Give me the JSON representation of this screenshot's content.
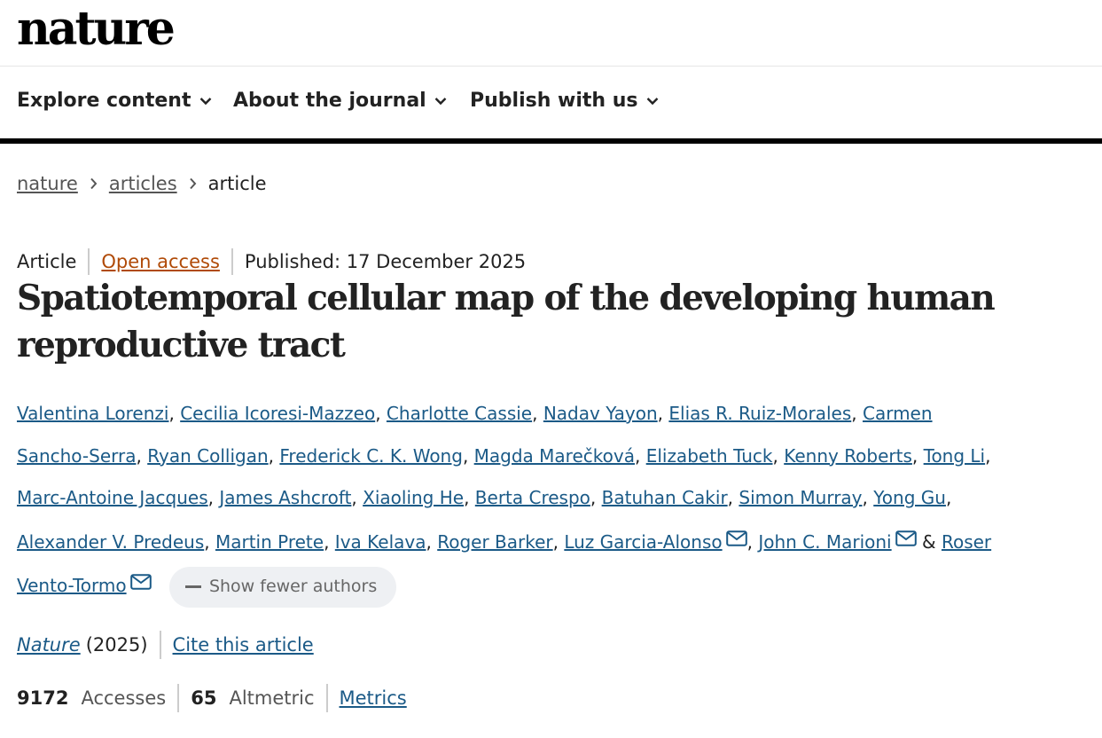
{
  "header": {
    "logo": "nature"
  },
  "nav": {
    "items": [
      {
        "label": "Explore content"
      },
      {
        "label": "About the journal"
      },
      {
        "label": "Publish with us"
      }
    ]
  },
  "breadcrumb": {
    "items": [
      "nature",
      "articles"
    ],
    "current": "article"
  },
  "meta": {
    "type": "Article",
    "access": "Open access",
    "published": "Published: 17 December 2025"
  },
  "article": {
    "title": "Spatiotemporal cellular map of the developing human reproductive tract"
  },
  "authors": {
    "list": [
      "Valentina Lorenzi",
      "Cecilia Icoresi-Mazzeo",
      "Charlotte Cassie",
      "Nadav Yayon",
      "Elias R. Ruiz-Morales",
      "Carmen Sancho-Serra",
      "Ryan Colligan",
      "Frederick C. K. Wong",
      "Magda Marečková",
      "Elizabeth Tuck",
      "Kenny Roberts",
      "Tong Li",
      "Marc-Antoine Jacques",
      "James Ashcroft",
      "Xiaoling He",
      "Berta Crespo",
      "Batuhan Cakir",
      "Simon Murray",
      "Yong Gu",
      "Alexander V. Predeus",
      "Martin Prete",
      "Iva Kelava",
      "Roger Barker",
      "Luz Garcia-Alonso",
      "John C. Marioni",
      "Roser Vento-Tormo"
    ],
    "mail_icon": "mail-icon",
    "and": "&",
    "show_fewer": "Show fewer authors"
  },
  "citation": {
    "journal": "Nature",
    "year": "(2025)",
    "cite": "Cite this article"
  },
  "metrics": {
    "accesses_value": "9172",
    "accesses_label": "Accesses",
    "altmetric_value": "65",
    "altmetric_label": "Altmetric",
    "metrics_link": "Metrics"
  }
}
